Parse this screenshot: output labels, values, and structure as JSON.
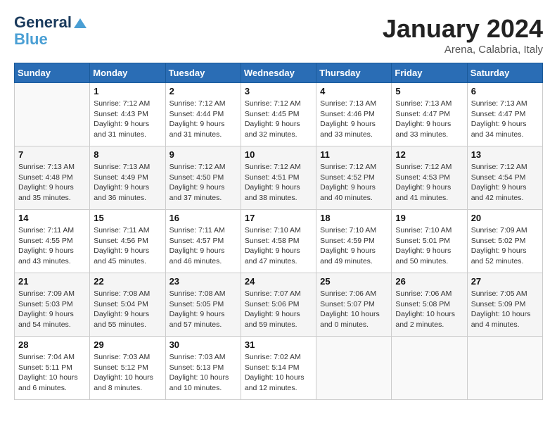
{
  "header": {
    "logo_line1": "General",
    "logo_line2": "Blue",
    "month": "January 2024",
    "location": "Arena, Calabria, Italy"
  },
  "days_of_week": [
    "Sunday",
    "Monday",
    "Tuesday",
    "Wednesday",
    "Thursday",
    "Friday",
    "Saturday"
  ],
  "weeks": [
    [
      {
        "day": "",
        "info": ""
      },
      {
        "day": "1",
        "info": "Sunrise: 7:12 AM\nSunset: 4:43 PM\nDaylight: 9 hours\nand 31 minutes."
      },
      {
        "day": "2",
        "info": "Sunrise: 7:12 AM\nSunset: 4:44 PM\nDaylight: 9 hours\nand 31 minutes."
      },
      {
        "day": "3",
        "info": "Sunrise: 7:12 AM\nSunset: 4:45 PM\nDaylight: 9 hours\nand 32 minutes."
      },
      {
        "day": "4",
        "info": "Sunrise: 7:13 AM\nSunset: 4:46 PM\nDaylight: 9 hours\nand 33 minutes."
      },
      {
        "day": "5",
        "info": "Sunrise: 7:13 AM\nSunset: 4:47 PM\nDaylight: 9 hours\nand 33 minutes."
      },
      {
        "day": "6",
        "info": "Sunrise: 7:13 AM\nSunset: 4:47 PM\nDaylight: 9 hours\nand 34 minutes."
      }
    ],
    [
      {
        "day": "7",
        "info": "Sunrise: 7:13 AM\nSunset: 4:48 PM\nDaylight: 9 hours\nand 35 minutes."
      },
      {
        "day": "8",
        "info": "Sunrise: 7:13 AM\nSunset: 4:49 PM\nDaylight: 9 hours\nand 36 minutes."
      },
      {
        "day": "9",
        "info": "Sunrise: 7:12 AM\nSunset: 4:50 PM\nDaylight: 9 hours\nand 37 minutes."
      },
      {
        "day": "10",
        "info": "Sunrise: 7:12 AM\nSunset: 4:51 PM\nDaylight: 9 hours\nand 38 minutes."
      },
      {
        "day": "11",
        "info": "Sunrise: 7:12 AM\nSunset: 4:52 PM\nDaylight: 9 hours\nand 40 minutes."
      },
      {
        "day": "12",
        "info": "Sunrise: 7:12 AM\nSunset: 4:53 PM\nDaylight: 9 hours\nand 41 minutes."
      },
      {
        "day": "13",
        "info": "Sunrise: 7:12 AM\nSunset: 4:54 PM\nDaylight: 9 hours\nand 42 minutes."
      }
    ],
    [
      {
        "day": "14",
        "info": "Sunrise: 7:11 AM\nSunset: 4:55 PM\nDaylight: 9 hours\nand 43 minutes."
      },
      {
        "day": "15",
        "info": "Sunrise: 7:11 AM\nSunset: 4:56 PM\nDaylight: 9 hours\nand 45 minutes."
      },
      {
        "day": "16",
        "info": "Sunrise: 7:11 AM\nSunset: 4:57 PM\nDaylight: 9 hours\nand 46 minutes."
      },
      {
        "day": "17",
        "info": "Sunrise: 7:10 AM\nSunset: 4:58 PM\nDaylight: 9 hours\nand 47 minutes."
      },
      {
        "day": "18",
        "info": "Sunrise: 7:10 AM\nSunset: 4:59 PM\nDaylight: 9 hours\nand 49 minutes."
      },
      {
        "day": "19",
        "info": "Sunrise: 7:10 AM\nSunset: 5:01 PM\nDaylight: 9 hours\nand 50 minutes."
      },
      {
        "day": "20",
        "info": "Sunrise: 7:09 AM\nSunset: 5:02 PM\nDaylight: 9 hours\nand 52 minutes."
      }
    ],
    [
      {
        "day": "21",
        "info": "Sunrise: 7:09 AM\nSunset: 5:03 PM\nDaylight: 9 hours\nand 54 minutes."
      },
      {
        "day": "22",
        "info": "Sunrise: 7:08 AM\nSunset: 5:04 PM\nDaylight: 9 hours\nand 55 minutes."
      },
      {
        "day": "23",
        "info": "Sunrise: 7:08 AM\nSunset: 5:05 PM\nDaylight: 9 hours\nand 57 minutes."
      },
      {
        "day": "24",
        "info": "Sunrise: 7:07 AM\nSunset: 5:06 PM\nDaylight: 9 hours\nand 59 minutes."
      },
      {
        "day": "25",
        "info": "Sunrise: 7:06 AM\nSunset: 5:07 PM\nDaylight: 10 hours\nand 0 minutes."
      },
      {
        "day": "26",
        "info": "Sunrise: 7:06 AM\nSunset: 5:08 PM\nDaylight: 10 hours\nand 2 minutes."
      },
      {
        "day": "27",
        "info": "Sunrise: 7:05 AM\nSunset: 5:09 PM\nDaylight: 10 hours\nand 4 minutes."
      }
    ],
    [
      {
        "day": "28",
        "info": "Sunrise: 7:04 AM\nSunset: 5:11 PM\nDaylight: 10 hours\nand 6 minutes."
      },
      {
        "day": "29",
        "info": "Sunrise: 7:03 AM\nSunset: 5:12 PM\nDaylight: 10 hours\nand 8 minutes."
      },
      {
        "day": "30",
        "info": "Sunrise: 7:03 AM\nSunset: 5:13 PM\nDaylight: 10 hours\nand 10 minutes."
      },
      {
        "day": "31",
        "info": "Sunrise: 7:02 AM\nSunset: 5:14 PM\nDaylight: 10 hours\nand 12 minutes."
      },
      {
        "day": "",
        "info": ""
      },
      {
        "day": "",
        "info": ""
      },
      {
        "day": "",
        "info": ""
      }
    ]
  ]
}
